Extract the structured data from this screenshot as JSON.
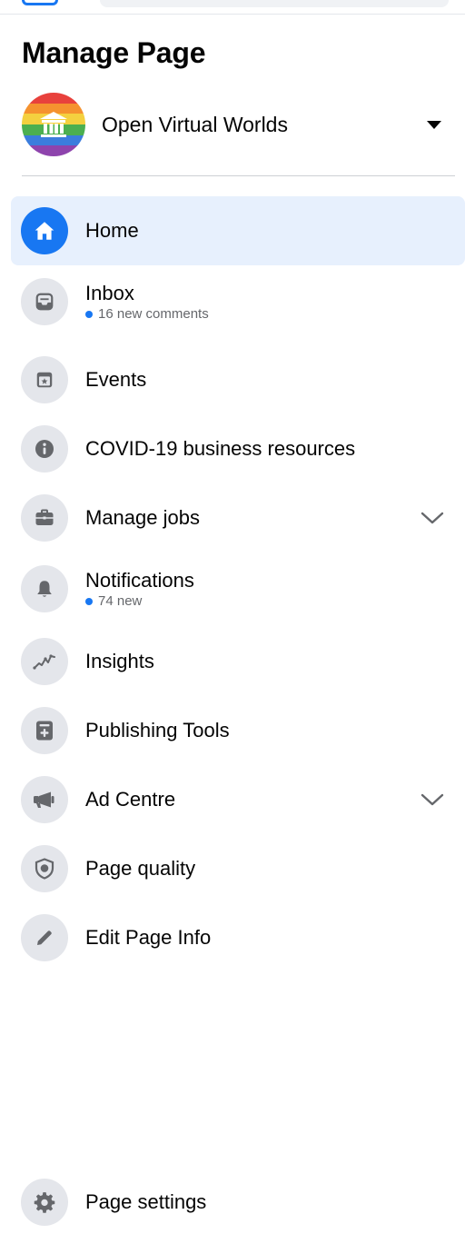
{
  "header": {
    "title": "Manage Page"
  },
  "page_switcher": {
    "name": "Open Virtual Worlds"
  },
  "nav": {
    "items": [
      {
        "label": "Home",
        "sub": "",
        "icon": "home-icon",
        "active": true,
        "expandable": false
      },
      {
        "label": "Inbox",
        "sub": "16 new comments",
        "icon": "inbox-icon",
        "active": false,
        "expandable": false
      },
      {
        "label": "Events",
        "sub": "",
        "icon": "calendar-icon",
        "active": false,
        "expandable": false
      },
      {
        "label": "COVID-19 business resources",
        "sub": "",
        "icon": "info-icon",
        "active": false,
        "expandable": false
      },
      {
        "label": "Manage jobs",
        "sub": "",
        "icon": "briefcase-icon",
        "active": false,
        "expandable": true
      },
      {
        "label": "Notifications",
        "sub": "74 new",
        "icon": "bell-icon",
        "active": false,
        "expandable": false
      },
      {
        "label": "Insights",
        "sub": "",
        "icon": "chart-icon",
        "active": false,
        "expandable": false
      },
      {
        "label": "Publishing Tools",
        "sub": "",
        "icon": "publishing-icon",
        "active": false,
        "expandable": false
      },
      {
        "label": "Ad Centre",
        "sub": "",
        "icon": "megaphone-icon",
        "active": false,
        "expandable": true
      },
      {
        "label": "Page quality",
        "sub": "",
        "icon": "shield-icon",
        "active": false,
        "expandable": false
      },
      {
        "label": "Edit Page Info",
        "sub": "",
        "icon": "pencil-icon",
        "active": false,
        "expandable": false
      }
    ]
  },
  "footer": {
    "settings_label": "Page settings",
    "settings_icon": "gear-icon"
  },
  "colors": {
    "accent": "#1877f2",
    "active_bg": "#e7f0fd",
    "icon_bg": "#e4e6eb",
    "text": "#050505",
    "secondary": "#65676b"
  }
}
